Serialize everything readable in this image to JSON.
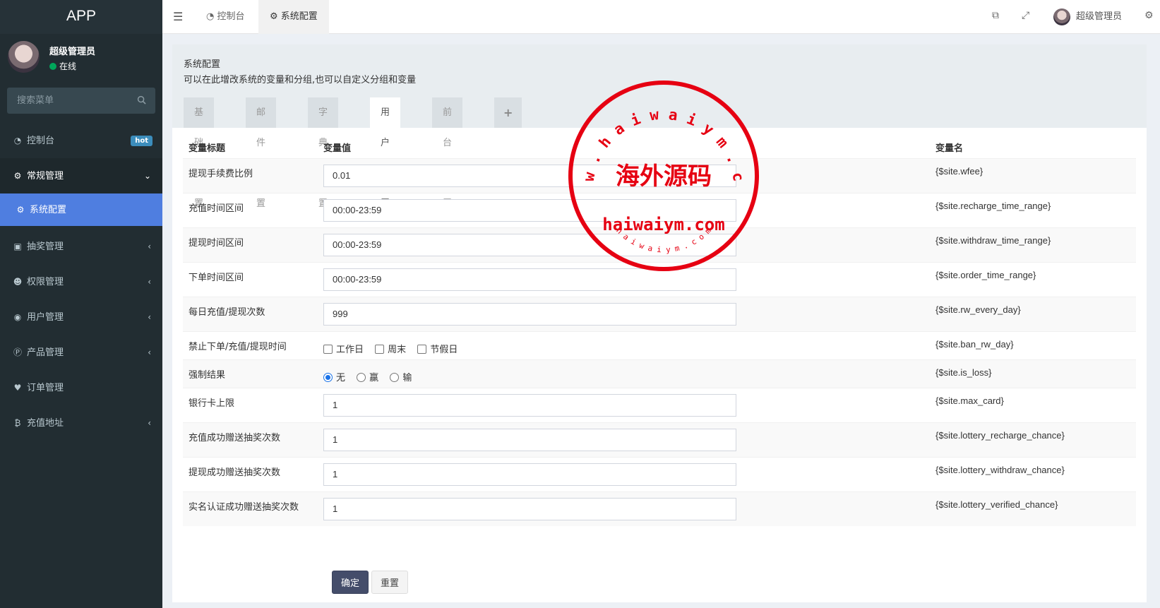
{
  "app": {
    "logo": "APP"
  },
  "user": {
    "name": "超级管理员",
    "status": "在线"
  },
  "search": {
    "placeholder": "搜索菜单"
  },
  "menu": {
    "dashboard": {
      "label": "控制台",
      "badge": "hot"
    },
    "general": {
      "label": "常规管理"
    },
    "sysconfig": {
      "label": "系统配置"
    },
    "lottery": {
      "label": "抽奖管理"
    },
    "permission": {
      "label": "权限管理"
    },
    "users": {
      "label": "用户管理"
    },
    "products": {
      "label": "产品管理"
    },
    "orders": {
      "label": "订单管理"
    },
    "recharge": {
      "label": "充值地址"
    }
  },
  "header": {
    "tab_dashboard": "控制台",
    "tab_sysconfig": "系统配置",
    "user_name": "超级管理员"
  },
  "panel": {
    "title": "系统配置",
    "description": "可以在此增改系统的变量和分组,也可以自定义分组和变量",
    "tabs": [
      "基础配置",
      "邮件配置",
      "字典配置",
      "用户配置",
      "前台配置"
    ],
    "add_tab": "+",
    "active_tab": "用户配置"
  },
  "table": {
    "headers": {
      "title": "变量标题",
      "value": "变量值",
      "name": "变量名"
    },
    "rows": [
      {
        "title": "提现手续费比例",
        "value": "0.01",
        "name": "{$site.wfee}"
      },
      {
        "title": "充值时间区间",
        "value": "00:00-23:59",
        "name": "{$site.recharge_time_range}"
      },
      {
        "title": "提现时间区间",
        "value": "00:00-23:59",
        "name": "{$site.withdraw_time_range}"
      },
      {
        "title": "下单时间区间",
        "value": "00:00-23:59",
        "name": "{$site.order_time_range}"
      },
      {
        "title": "每日充值/提现次数",
        "value": "999",
        "name": "{$site.rw_every_day}"
      },
      {
        "title": "禁止下单/充值/提现时间",
        "options": [
          "工作日",
          "周末",
          "节假日"
        ],
        "name": "{$site.ban_rw_day}"
      },
      {
        "title": "强制结果",
        "options": [
          "无",
          "赢",
          "输"
        ],
        "selected": "无",
        "name": "{$site.is_loss}"
      },
      {
        "title": "银行卡上限",
        "value": "1",
        "name": "{$site.max_card}"
      },
      {
        "title": "充值成功赠送抽奖次数",
        "value": "1",
        "name": "{$site.lottery_recharge_chance}"
      },
      {
        "title": "提现成功赠送抽奖次数",
        "value": "1",
        "name": "{$site.lottery_withdraw_chance}"
      },
      {
        "title": "实名认证成功赠送抽奖次数",
        "value": "1",
        "name": "{$site.lottery_verified_chance}"
      }
    ]
  },
  "buttons": {
    "submit": "确定",
    "reset": "重置"
  },
  "watermark": {
    "top_arc": "w w w . h a i w a i y m . c o m",
    "center": "海外源码",
    "domain": "haiwaiym.com",
    "bottom_arc": "h a i w a i y m . c o m",
    "color": "#e60012"
  },
  "colors": {
    "sidebar": "#222d32",
    "active_menu": "#4f7ee0",
    "hot_badge": "#3c8dbc",
    "online": "#00a65a"
  }
}
